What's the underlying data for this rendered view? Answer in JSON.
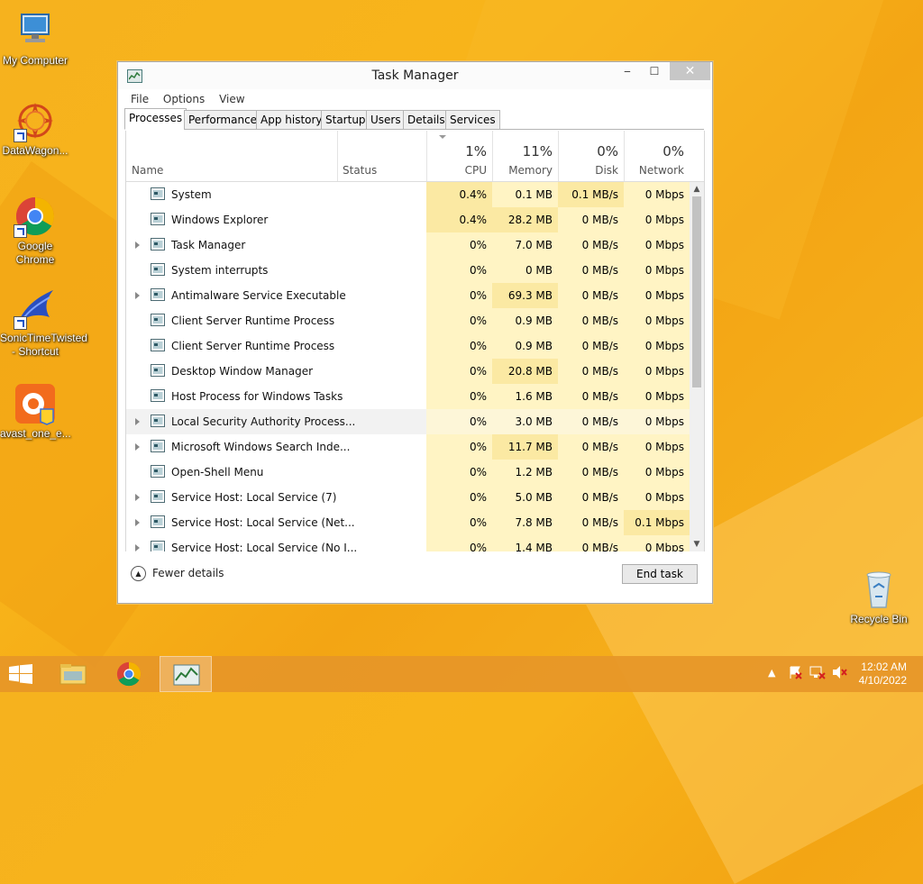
{
  "desktop": {
    "icons": [
      {
        "label": "My Computer"
      },
      {
        "label": "DataWagon..."
      },
      {
        "label": "Google Chrome"
      },
      {
        "label": "SonicTimeTwisted - Shortcut"
      },
      {
        "label": "avast_one_e..."
      },
      {
        "label": "Recycle Bin"
      }
    ]
  },
  "window": {
    "title": "Task Manager",
    "controls": {
      "minimize": "‒",
      "maximize": "☐",
      "close": "✕"
    },
    "menu": [
      "File",
      "Options",
      "View"
    ],
    "tabs": [
      "Processes",
      "Performance",
      "App history",
      "Startup",
      "Users",
      "Details",
      "Services"
    ],
    "active_tab": "Processes"
  },
  "columns": {
    "name": "Name",
    "status": "Status",
    "cpu": {
      "pct": "1%",
      "label": "CPU"
    },
    "memory": {
      "pct": "11%",
      "label": "Memory"
    },
    "disk": {
      "pct": "0%",
      "label": "Disk"
    },
    "network": {
      "pct": "0%",
      "label": "Network"
    }
  },
  "processes": [
    {
      "name": "System",
      "cpu": "0.4%",
      "mem": "0.1 MB",
      "disk": "0.1 MB/s",
      "net": "0 Mbps"
    },
    {
      "name": "Windows Explorer",
      "cpu": "0.4%",
      "mem": "28.2 MB",
      "disk": "0 MB/s",
      "net": "0 Mbps"
    },
    {
      "name": "Task Manager",
      "cpu": "0%",
      "mem": "7.0 MB",
      "disk": "0 MB/s",
      "net": "0 Mbps"
    },
    {
      "name": "System interrupts",
      "cpu": "0%",
      "mem": "0 MB",
      "disk": "0 MB/s",
      "net": "0 Mbps"
    },
    {
      "name": "Antimalware Service Executable",
      "cpu": "0%",
      "mem": "69.3 MB",
      "disk": "0 MB/s",
      "net": "0 Mbps"
    },
    {
      "name": "Client Server Runtime Process",
      "cpu": "0%",
      "mem": "0.9 MB",
      "disk": "0 MB/s",
      "net": "0 Mbps"
    },
    {
      "name": "Client Server Runtime Process",
      "cpu": "0%",
      "mem": "0.9 MB",
      "disk": "0 MB/s",
      "net": "0 Mbps"
    },
    {
      "name": "Desktop Window Manager",
      "cpu": "0%",
      "mem": "20.8 MB",
      "disk": "0 MB/s",
      "net": "0 Mbps"
    },
    {
      "name": "Host Process for Windows Tasks",
      "cpu": "0%",
      "mem": "1.6 MB",
      "disk": "0 MB/s",
      "net": "0 Mbps"
    },
    {
      "name": "Local Security Authority Process...",
      "cpu": "0%",
      "mem": "3.0 MB",
      "disk": "0 MB/s",
      "net": "0 Mbps"
    },
    {
      "name": "Microsoft Windows Search Inde...",
      "cpu": "0%",
      "mem": "11.7 MB",
      "disk": "0 MB/s",
      "net": "0 Mbps"
    },
    {
      "name": "Open-Shell Menu",
      "cpu": "0%",
      "mem": "1.2 MB",
      "disk": "0 MB/s",
      "net": "0 Mbps"
    },
    {
      "name": "Service Host: Local Service (7)",
      "cpu": "0%",
      "mem": "5.0 MB",
      "disk": "0 MB/s",
      "net": "0 Mbps"
    },
    {
      "name": "Service Host: Local Service (Net...",
      "cpu": "0%",
      "mem": "7.8 MB",
      "disk": "0 MB/s",
      "net": "0.1 Mbps"
    },
    {
      "name": "Service Host: Local Service (No I...",
      "cpu": "0%",
      "mem": "1.4 MB",
      "disk": "0 MB/s",
      "net": "0 Mbps"
    }
  ],
  "footer": {
    "fewer_details": "Fewer details",
    "end_task": "End task"
  },
  "taskbar": {
    "time": "12:02 AM",
    "date": "4/10/2022"
  },
  "colors": {
    "heat_light": "#fff4c4",
    "heat_mid": "#fbe9a3"
  }
}
